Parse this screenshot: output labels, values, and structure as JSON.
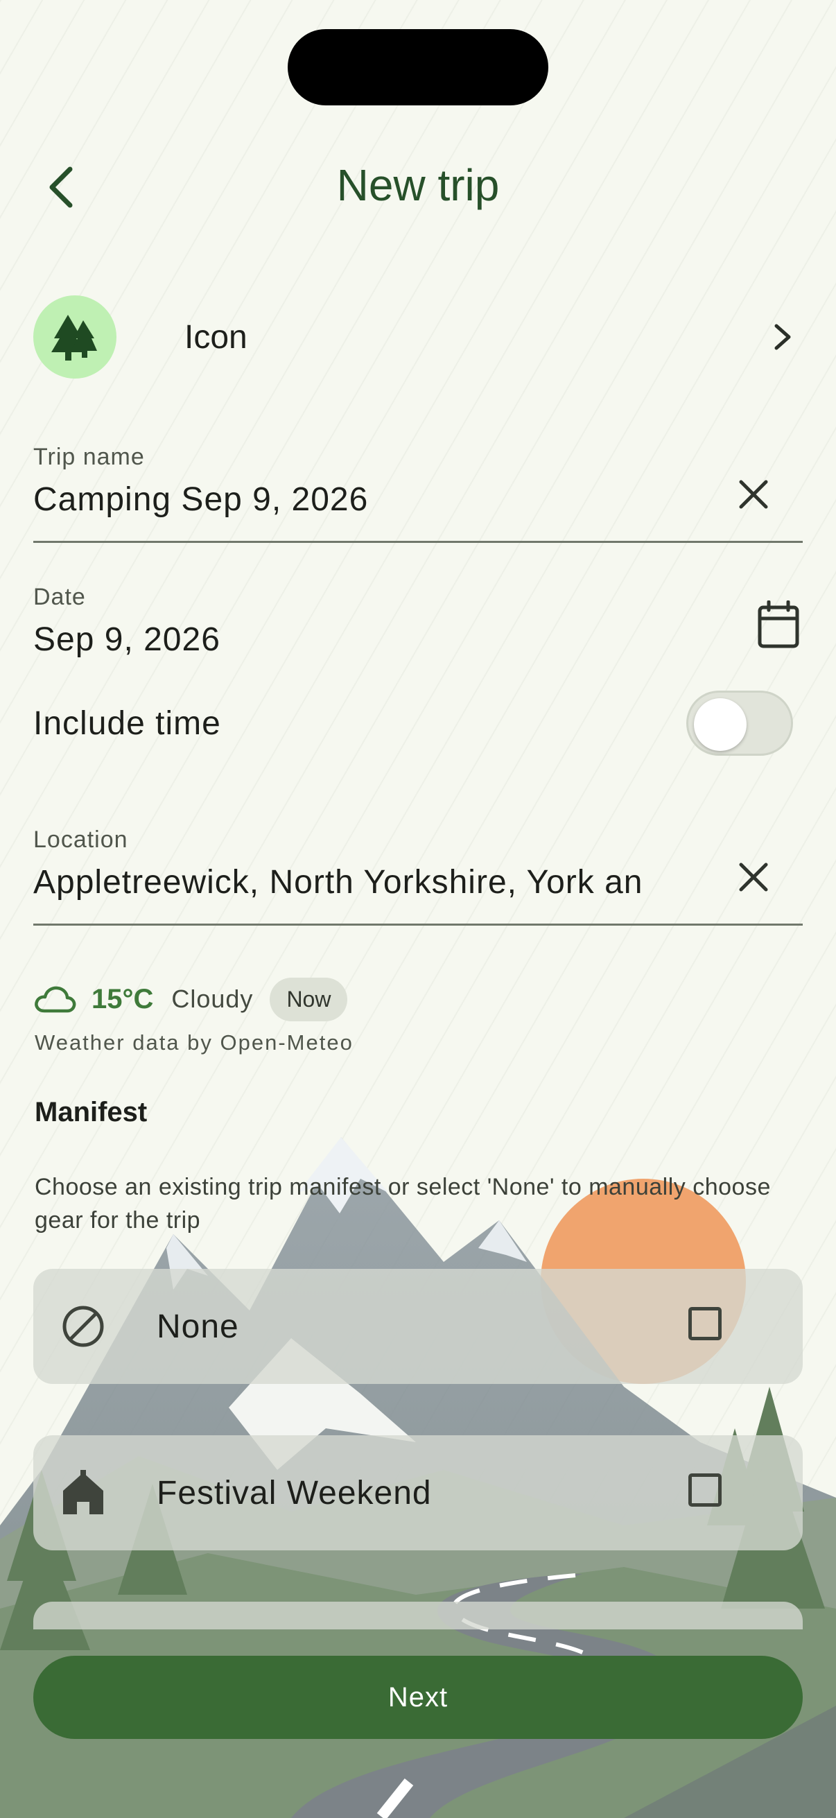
{
  "header": {
    "title": "New trip"
  },
  "icon_row": {
    "label": "Icon",
    "icon": "tree-icon"
  },
  "trip_name": {
    "label": "Trip name",
    "value": "Camping Sep 9, 2026"
  },
  "date": {
    "label": "Date",
    "value": "Sep 9, 2026"
  },
  "include_time": {
    "label": "Include time",
    "enabled": false
  },
  "location": {
    "label": "Location",
    "value": "Appletreewick, North Yorkshire, York an"
  },
  "weather": {
    "temperature": "15°C",
    "condition": "Cloudy",
    "chip": "Now",
    "credit": "Weather data by Open-Meteo"
  },
  "manifest": {
    "title": "Manifest",
    "description": "Choose an existing trip manifest or select 'None' to manually choose gear for the trip",
    "options": [
      {
        "label": "None",
        "icon": "none-icon",
        "checked": false
      },
      {
        "label": "Festival Weekend",
        "icon": "tent-icon",
        "checked": false
      }
    ]
  },
  "footer": {
    "next_label": "Next"
  },
  "colors": {
    "primary": "#3a6b35",
    "title": "#27502a",
    "icon_bg": "#bff0b3",
    "background": "#f6f8f0"
  }
}
